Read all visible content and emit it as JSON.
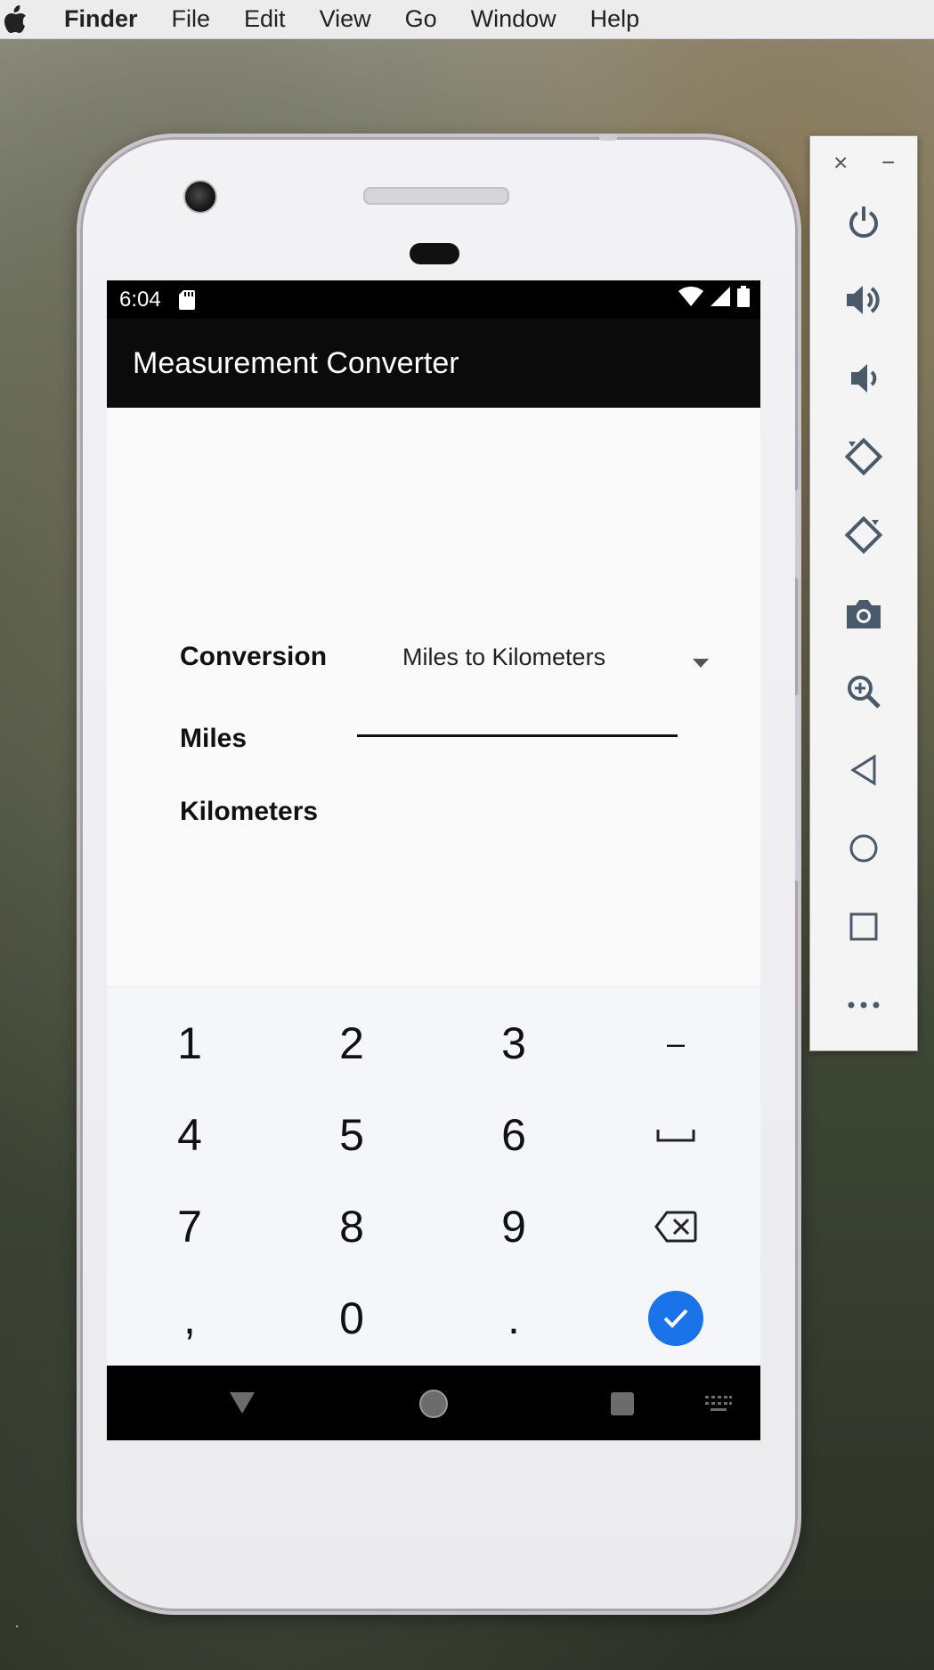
{
  "menubar": {
    "apple_icon": "apple-icon",
    "items": [
      "Finder",
      "File",
      "Edit",
      "View",
      "Go",
      "Window",
      "Help"
    ]
  },
  "phone": {
    "statusbar": {
      "time": "6:04",
      "icons": [
        "sd-card-icon",
        "wifi-icon",
        "signal-icon",
        "battery-icon"
      ]
    },
    "appbar": {
      "title": "Measurement Converter"
    },
    "form": {
      "conversion_label": "Conversion",
      "conversion_value": "Miles to Kilometers",
      "miles_label": "Miles",
      "miles_value": "",
      "kilometers_label": "Kilometers",
      "kilometers_value": ""
    },
    "keypad": {
      "keys": [
        "1",
        "2",
        "3",
        "–",
        "4",
        "5",
        "6",
        "␣",
        "7",
        "8",
        "9",
        "⌫",
        ",",
        "0",
        ".",
        "✓"
      ],
      "confirm_color": "#1a73e8"
    },
    "navbar": {
      "buttons": [
        "back-icon",
        "home-icon",
        "recents-icon",
        "keyboard-icon"
      ]
    }
  },
  "emulator_panel": {
    "window_controls": [
      "close-icon",
      "minimize-icon"
    ],
    "buttons": [
      "power-icon",
      "volume-up-icon",
      "volume-down-icon",
      "rotate-left-icon",
      "rotate-right-icon",
      "camera-icon",
      "zoom-icon",
      "back-icon",
      "home-icon",
      "overview-icon",
      "more-icon"
    ],
    "close_glyph": "×",
    "minimize_glyph": "−"
  }
}
